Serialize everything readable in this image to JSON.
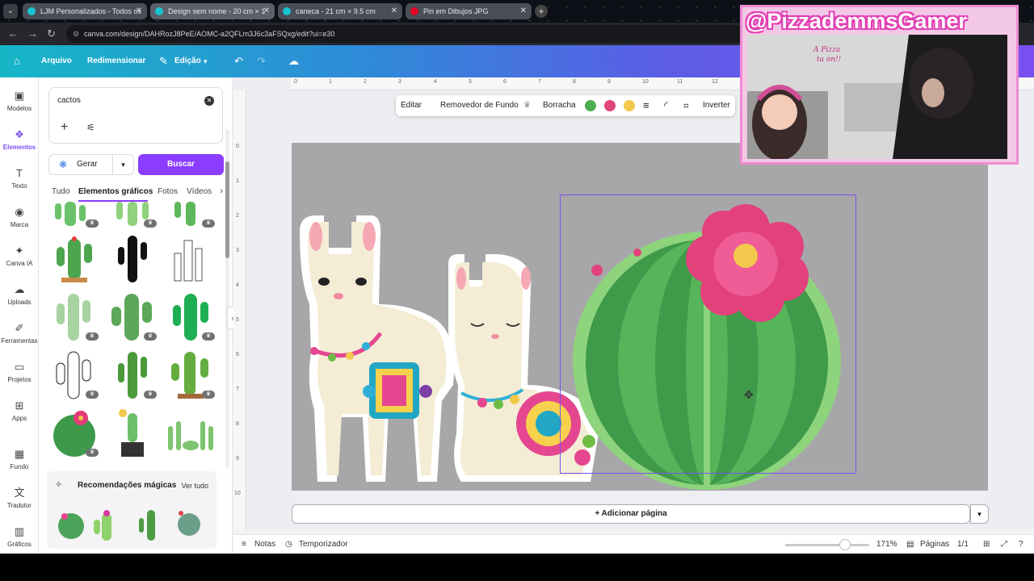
{
  "browser": {
    "tabs": [
      {
        "title": "LJM Personalizados - Todos os"
      },
      {
        "title": "Design sem nome - 20 cm × 1"
      },
      {
        "title": "caneca - 21 cm × 9.5 cm"
      },
      {
        "title": "Pin em Dibujos JPG"
      }
    ],
    "url": "canva.com/design/DAHRozJ8PeE/AOMC-a2QFLm3J6c3aFSQxg/edit?ui=e30"
  },
  "header": {
    "arquivo": "Arquivo",
    "redimensionar": "Redimensionar",
    "edicao": "Edição"
  },
  "rail": {
    "items": [
      {
        "label": "Modelos",
        "icon": "templates-icon"
      },
      {
        "label": "Elementos",
        "icon": "elements-icon"
      },
      {
        "label": "Texto",
        "icon": "text-icon"
      },
      {
        "label": "Marca",
        "icon": "brand-icon"
      },
      {
        "label": "Canva IA",
        "icon": "ai-icon"
      },
      {
        "label": "Uploads",
        "icon": "upload-icon"
      },
      {
        "label": "Ferramentas",
        "icon": "tools-icon"
      },
      {
        "label": "Projetos",
        "icon": "folder-icon"
      },
      {
        "label": "Apps",
        "icon": "apps-icon"
      },
      {
        "label": "Fundo",
        "icon": "background-icon"
      },
      {
        "label": "Tradutor",
        "icon": "translate-icon"
      },
      {
        "label": "Gráficos",
        "icon": "charts-icon"
      }
    ]
  },
  "panel": {
    "search_value": "cactos",
    "gerar": "Gerar",
    "buscar": "Buscar",
    "tabs": [
      "Tudo",
      "Elementos gráficos",
      "Fotos",
      "Vídeos"
    ],
    "magic_title": "Recomendações mágicas",
    "magic_link": "Ver tudo"
  },
  "toolbar": {
    "editar": "Editar",
    "remover_fundo": "Removedor de Fundo",
    "borracha": "Borracha",
    "inverter": "Inverter",
    "colors": [
      "#4caf50",
      "#e0457b",
      "#f2c94c"
    ]
  },
  "ruler": {
    "h": [
      "0",
      "1",
      "2",
      "3",
      "4",
      "5",
      "6",
      "7",
      "8",
      "9",
      "10",
      "11",
      "12"
    ],
    "v": [
      "0",
      "1",
      "2",
      "3",
      "4",
      "5",
      "6",
      "7",
      "8",
      "9",
      "10"
    ]
  },
  "canvas": {
    "add_page": "+ Adicionar página"
  },
  "footer": {
    "notas": "Notas",
    "temporizador": "Temporizador",
    "zoom": "171%",
    "paginas": "Páginas",
    "page_count": "1/1",
    "zoom_level": 0.71
  },
  "webcam": {
    "handle": "@PizzademmsGamer",
    "sign_line1": "A Pizza",
    "sign_line2": "ta on!!"
  }
}
